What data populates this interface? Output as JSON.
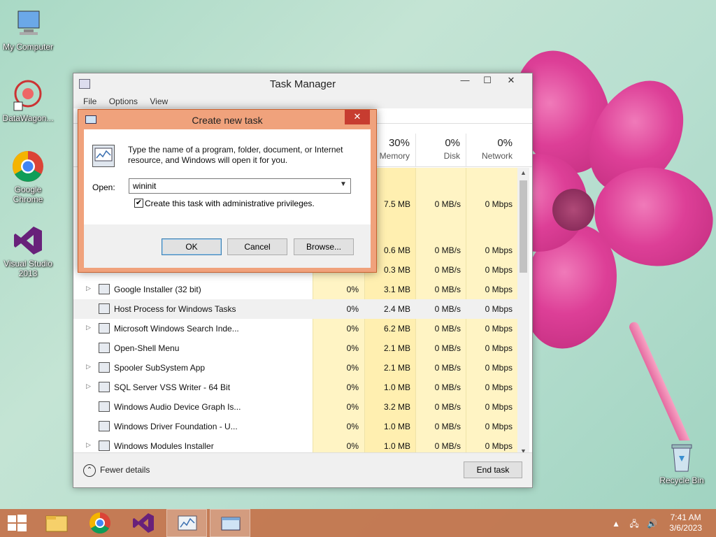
{
  "desktop": {
    "icons": [
      {
        "label": "My Computer",
        "icon": "computer-icon"
      },
      {
        "label": "DataWagon...",
        "icon": "datawagon-icon"
      },
      {
        "label": "Google Chrome",
        "icon": "chrome-icon"
      },
      {
        "label": "Visual Studio 2013",
        "icon": "visual-studio-icon"
      },
      {
        "label": "Recycle Bin",
        "icon": "recycle-bin-icon"
      }
    ]
  },
  "task_manager": {
    "title": "Task Manager",
    "window_buttons": {
      "minimize": "—",
      "maximize": "☐",
      "close": "✕"
    },
    "menu": [
      "File",
      "Options",
      "View"
    ],
    "columns": [
      {
        "pct": "30%",
        "label": "Memory"
      },
      {
        "pct": "0%",
        "label": "Disk"
      },
      {
        "pct": "0%",
        "label": "Network"
      }
    ],
    "partial_rows": [
      {
        "memory": "7.5 MB",
        "disk": "0 MB/s",
        "network": "0 Mbps"
      },
      {
        "memory": "0.6 MB",
        "disk": "0 MB/s",
        "network": "0 Mbps"
      },
      {
        "memory": "0.3 MB",
        "disk": "0 MB/s",
        "network": "0 Mbps"
      }
    ],
    "rows": [
      {
        "name": "Google Installer (32 bit)",
        "expand": "▷",
        "cpu": "0%",
        "memory": "3.1 MB",
        "disk": "0 MB/s",
        "network": "0 Mbps"
      },
      {
        "name": "Host Process for Windows Tasks",
        "expand": "",
        "cpu": "0%",
        "memory": "2.4 MB",
        "disk": "0 MB/s",
        "network": "0 Mbps"
      },
      {
        "name": "Microsoft Windows Search Inde...",
        "expand": "▷",
        "cpu": "0%",
        "memory": "6.2 MB",
        "disk": "0 MB/s",
        "network": "0 Mbps"
      },
      {
        "name": "Open-Shell Menu",
        "expand": "",
        "cpu": "0%",
        "memory": "2.1 MB",
        "disk": "0 MB/s",
        "network": "0 Mbps"
      },
      {
        "name": "Spooler SubSystem App",
        "expand": "▷",
        "cpu": "0%",
        "memory": "2.1 MB",
        "disk": "0 MB/s",
        "network": "0 Mbps"
      },
      {
        "name": "SQL Server VSS Writer - 64 Bit",
        "expand": "▷",
        "cpu": "0%",
        "memory": "1.0 MB",
        "disk": "0 MB/s",
        "network": "0 Mbps"
      },
      {
        "name": "Windows Audio Device Graph Is...",
        "expand": "",
        "cpu": "0%",
        "memory": "3.2 MB",
        "disk": "0 MB/s",
        "network": "0 Mbps"
      },
      {
        "name": "Windows Driver Foundation - U...",
        "expand": "",
        "cpu": "0%",
        "memory": "1.0 MB",
        "disk": "0 MB/s",
        "network": "0 Mbps"
      },
      {
        "name": "Windows Modules Installer",
        "expand": "▷",
        "cpu": "0%",
        "memory": "1.0 MB",
        "disk": "0 MB/s",
        "network": "0 Mbps"
      }
    ],
    "fewer_details": "Fewer details",
    "end_task": "End task"
  },
  "run_dialog": {
    "title": "Create new task",
    "close": "✕",
    "message": "Type the name of a program, folder, document, or Internet resource, and Windows will open it for you.",
    "open_label": "Open:",
    "open_value": "wininit",
    "checkbox_label": "Create this task with administrative privileges.",
    "checkbox_checked": true,
    "ok": "OK",
    "cancel": "Cancel",
    "browse": "Browse..."
  },
  "taskbar": {
    "items": [
      "start-icon",
      "file-explorer-icon",
      "chrome-icon",
      "visual-studio-icon",
      "task-manager-icon",
      "run-dialog-icon"
    ],
    "tray_arrow": "▲",
    "time": "7:41 AM",
    "date": "3/6/2023"
  }
}
